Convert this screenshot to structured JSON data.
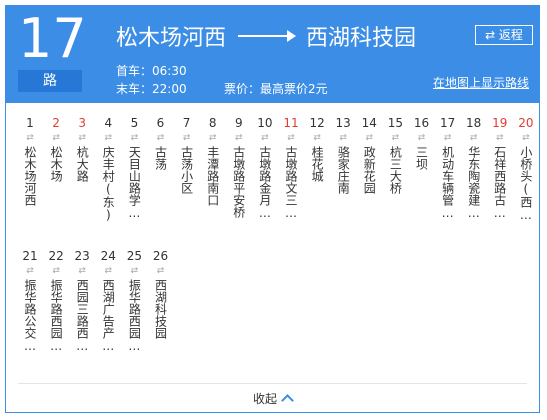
{
  "route": {
    "number": "17",
    "unit": "路"
  },
  "direction": {
    "from": "松木场河西",
    "to": "西湖科技园"
  },
  "return_button": {
    "icon": "swap-arrows-icon",
    "label": "⇄ 返程"
  },
  "schedule": {
    "first_bus": "首车：06:30",
    "last_bus": "末车：22:00",
    "fare": "票价：最高票价2元"
  },
  "map_link": "在地图上显示路线",
  "stops": [
    {
      "num": "1",
      "name": "松木场河西",
      "highlight": false
    },
    {
      "num": "2",
      "name": "松木场",
      "highlight": true
    },
    {
      "num": "3",
      "name": "杭大路",
      "highlight": true
    },
    {
      "num": "4",
      "name": "庆丰村(东)",
      "highlight": false
    },
    {
      "num": "5",
      "name": "天目山路学…",
      "highlight": false
    },
    {
      "num": "6",
      "name": "古荡",
      "highlight": false
    },
    {
      "num": "7",
      "name": "古荡小区",
      "highlight": false
    },
    {
      "num": "8",
      "name": "丰潭路南口",
      "highlight": false
    },
    {
      "num": "9",
      "name": "古墩路平安桥",
      "highlight": false
    },
    {
      "num": "10",
      "name": "古墩路金月…",
      "highlight": false
    },
    {
      "num": "11",
      "name": "古墩路文三…",
      "highlight": true
    },
    {
      "num": "12",
      "name": "桂花城",
      "highlight": false
    },
    {
      "num": "13",
      "name": "骆家庄南",
      "highlight": false
    },
    {
      "num": "14",
      "name": "政新花园",
      "highlight": false
    },
    {
      "num": "15",
      "name": "杭三大桥",
      "highlight": false
    },
    {
      "num": "16",
      "name": "三坝",
      "highlight": false
    },
    {
      "num": "17",
      "name": "机动车辆管…",
      "highlight": false
    },
    {
      "num": "18",
      "name": "华东陶瓷建…",
      "highlight": false
    },
    {
      "num": "19",
      "name": "石祥西路古…",
      "highlight": true
    },
    {
      "num": "20",
      "name": "小桥头(西…",
      "highlight": true
    },
    {
      "num": "21",
      "name": "振华路公交…",
      "highlight": false
    },
    {
      "num": "22",
      "name": "振华路西园…",
      "highlight": false
    },
    {
      "num": "23",
      "name": "西园三路西…",
      "highlight": false
    },
    {
      "num": "24",
      "name": "西湖广告产…",
      "highlight": false
    },
    {
      "num": "25",
      "name": "振华路西园…",
      "highlight": false
    },
    {
      "num": "26",
      "name": "西湖科技园",
      "highlight": false
    }
  ],
  "stop_swap_symbol": "⇄",
  "collapse": {
    "label": "收起",
    "icon": "chevron-up-icon"
  },
  "colors": {
    "header_bg": "#3c8de6",
    "unit_bg": "#2778d6",
    "highlight": "#e23b30",
    "text": "#333333"
  }
}
